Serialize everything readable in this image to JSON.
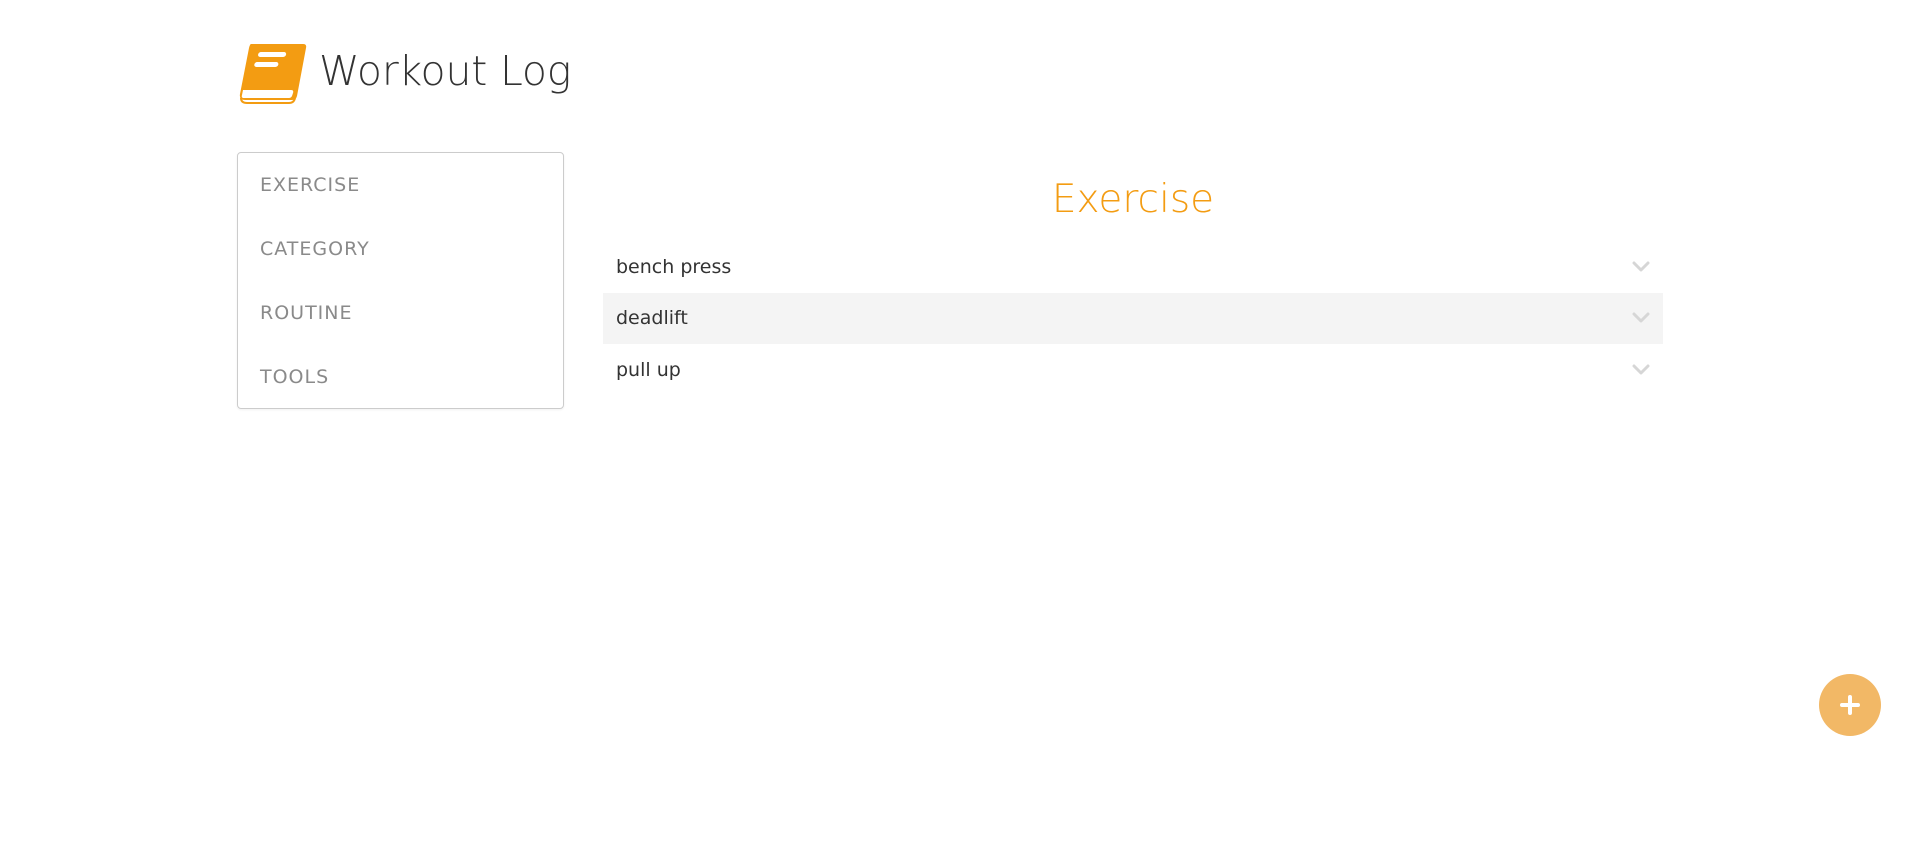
{
  "app": {
    "title": "Workout Log",
    "logo_icon": "book-icon",
    "accent_color": "#f39c12"
  },
  "sidebar": {
    "items": [
      {
        "label": "EXERCISE"
      },
      {
        "label": "CATEGORY"
      },
      {
        "label": "ROUTINE"
      },
      {
        "label": "TOOLS"
      }
    ]
  },
  "main": {
    "title": "Exercise",
    "exercises": [
      {
        "name": "bench press",
        "icon": "chevron-down-icon"
      },
      {
        "name": "deadlift",
        "icon": "chevron-down-icon"
      },
      {
        "name": "pull up",
        "icon": "chevron-down-icon"
      }
    ]
  },
  "fab": {
    "icon": "plus-icon",
    "color": "#f2b866"
  }
}
